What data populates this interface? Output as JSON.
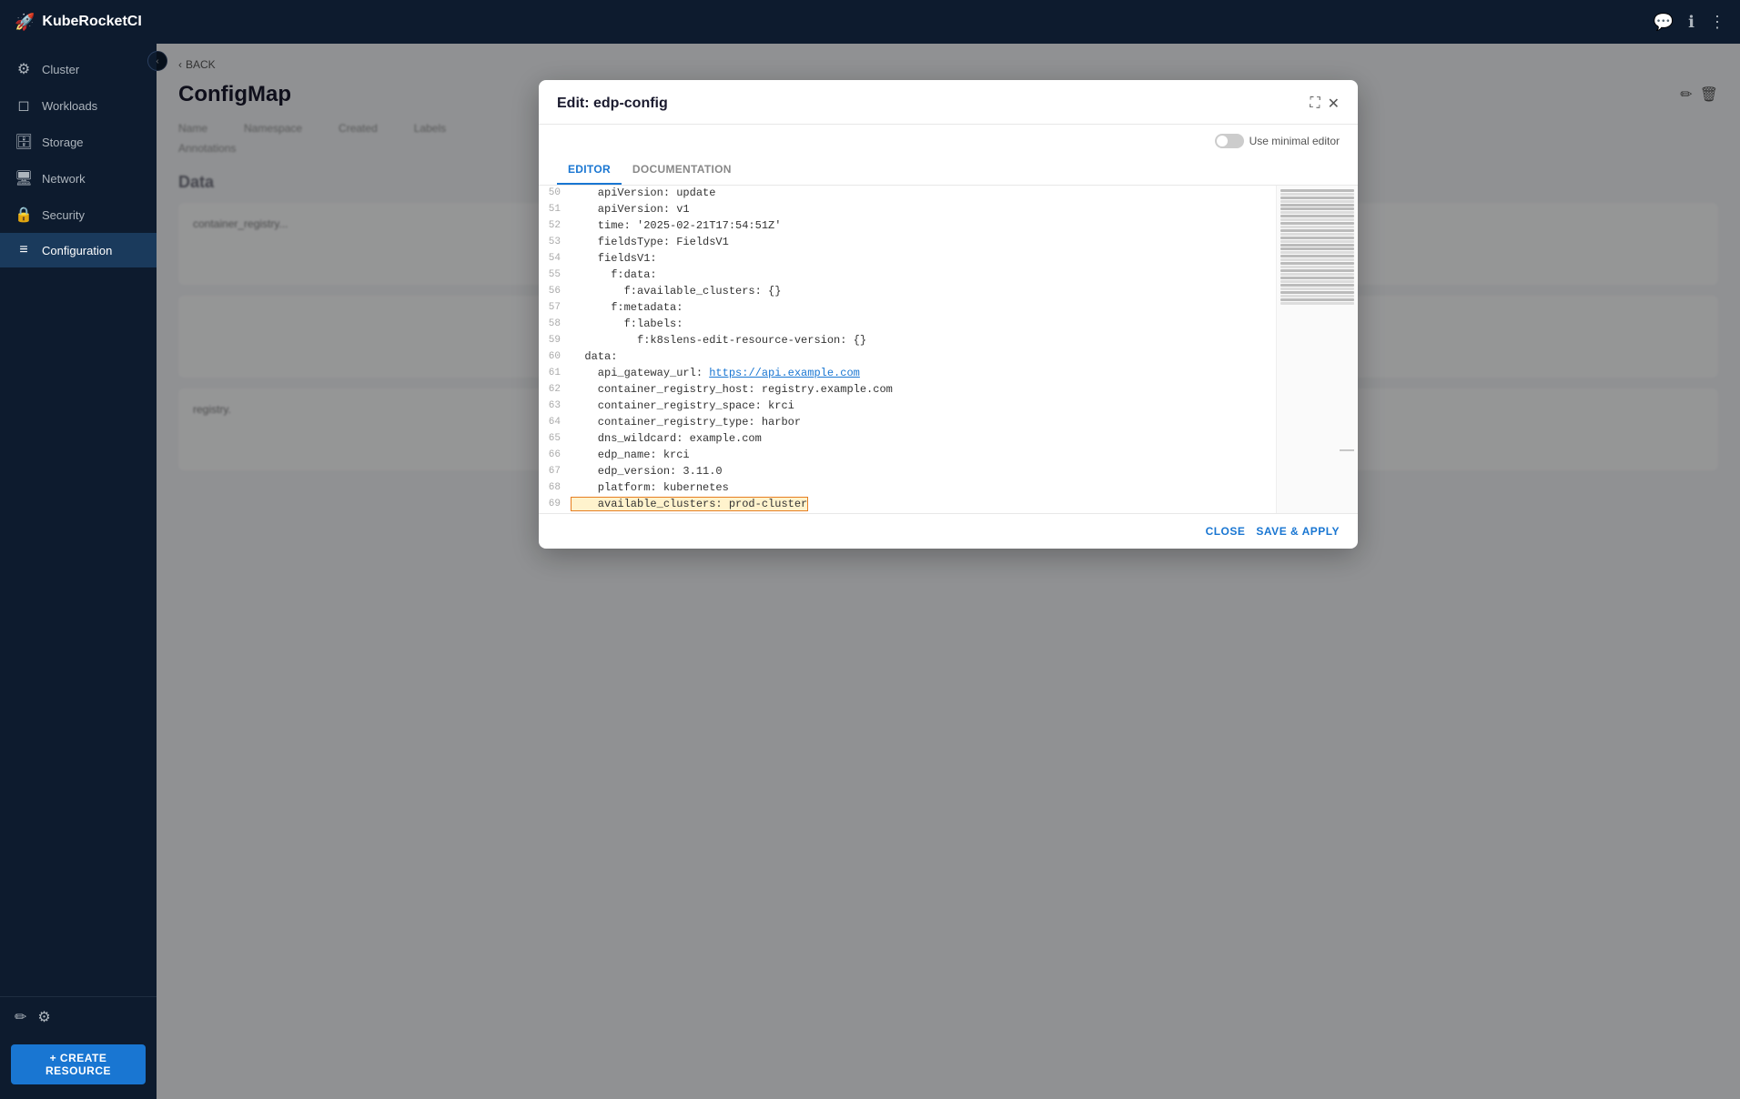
{
  "topbar": {
    "title": "KubeRocketCI",
    "logo_icon": "🚀"
  },
  "sidebar": {
    "collapse_icon": "‹",
    "items": [
      {
        "id": "cluster",
        "label": "Cluster",
        "icon": "⚙"
      },
      {
        "id": "workloads",
        "label": "Workloads",
        "icon": "◻"
      },
      {
        "id": "storage",
        "label": "Storage",
        "icon": "🗄"
      },
      {
        "id": "network",
        "label": "Network",
        "icon": "🖥"
      },
      {
        "id": "security",
        "label": "Security",
        "icon": "🔒"
      },
      {
        "id": "configuration",
        "label": "Configuration",
        "icon": "≡"
      }
    ],
    "bottom_icons": [
      "✏",
      "⚙"
    ],
    "create_resource_label": "+ CREATE RESOURCE"
  },
  "page": {
    "back_label": "BACK",
    "title": "ConfigMap",
    "edit_icon": "✏",
    "delete_icon": "🗑"
  },
  "modal": {
    "title": "Edit: edp-config",
    "expand_icon": "⛶",
    "close_icon": "✕",
    "use_minimal_label": "Use minimal editor",
    "tabs": [
      "EDITOR",
      "DOCUMENTATION"
    ],
    "active_tab": "EDITOR",
    "editor_lines": [
      {
        "num": "50",
        "content": "    apiVersion: update"
      },
      {
        "num": "51",
        "content": "    apiVersion: v1"
      },
      {
        "num": "52",
        "content": "    time: '2025-02-21T17:54:51Z'"
      },
      {
        "num": "53",
        "content": "    fieldsType: FieldsV1"
      },
      {
        "num": "54",
        "content": "    fieldsV1:"
      },
      {
        "num": "55",
        "content": "      f:data:"
      },
      {
        "num": "56",
        "content": "        f:available_clusters: {}"
      },
      {
        "num": "57",
        "content": "      f:metadata:"
      },
      {
        "num": "58",
        "content": "        f:labels:"
      },
      {
        "num": "59",
        "content": "          f:k8slens-edit-resource-version: {}"
      },
      {
        "num": "60",
        "content": "  data:"
      },
      {
        "num": "61",
        "content": "    api_gateway_url: https://api.example.com",
        "is_link": true,
        "link_start": 20,
        "link_text": "https://api.example.com"
      },
      {
        "num": "62",
        "content": "    container_registry_host: registry.example.com"
      },
      {
        "num": "63",
        "content": "    container_registry_space: krci"
      },
      {
        "num": "64",
        "content": "    container_registry_type: harbor"
      },
      {
        "num": "65",
        "content": "    dns_wildcard: example.com"
      },
      {
        "num": "66",
        "content": "    edp_name: krci"
      },
      {
        "num": "67",
        "content": "    edp_version: 3.11.0"
      },
      {
        "num": "68",
        "content": "    platform: kubernetes"
      },
      {
        "num": "69",
        "content": "    available_clusters: prod-cluster",
        "highlighted": true
      }
    ],
    "footer": {
      "close_label": "CLOSE",
      "save_apply_label": "SAVE & APPLY"
    }
  },
  "data_section": {
    "title": "Data",
    "cards": [
      {
        "id": "card1",
        "content": "container_registry..."
      },
      {
        "id": "card2",
        "content": ""
      },
      {
        "id": "card3",
        "content": "registry."
      }
    ]
  },
  "colors": {
    "brand": "#1976d2",
    "sidebar_bg": "#0d1b2e",
    "active_nav": "#1a3a5c"
  }
}
